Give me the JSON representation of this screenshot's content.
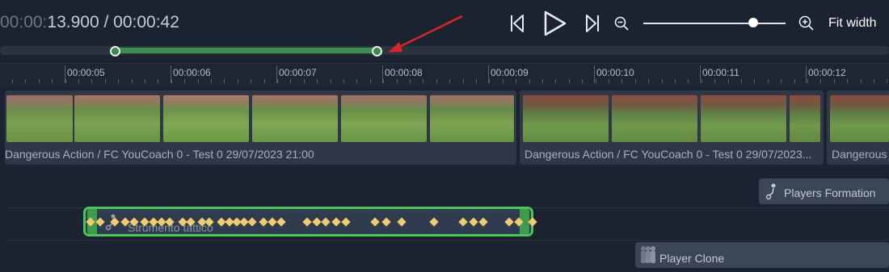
{
  "player": {
    "time_dim": "00:00:",
    "time_current": "13.900",
    "time_total_sep": " / ",
    "time_total": "00:00:42",
    "fit_width_label": "Fit width"
  },
  "ruler": {
    "labels": [
      "00:00:05",
      "00:00:06",
      "00:00:07",
      "00:00:08",
      "00:00:09",
      "00:00:10",
      "00:00:11",
      "00:00:12"
    ]
  },
  "clips": [
    {
      "label": "Dangerous Action / FC YouCoach 0 - Test 0 29/07/2023 21:00"
    },
    {
      "label": "Dangerous Action / FC YouCoach 0 - Test 0 29/07/2023..."
    },
    {
      "label": "Dangerous ..."
    }
  ],
  "tags": {
    "players_formation": "Players Formation",
    "player_clone": "Player Clone",
    "strumento_tattico": "Strumento tattico"
  },
  "colors": {
    "range_green": "#3e8e52",
    "selection_border": "#4ec35a",
    "keyframe": "#f1cc6e",
    "arrow": "#d6262b"
  }
}
